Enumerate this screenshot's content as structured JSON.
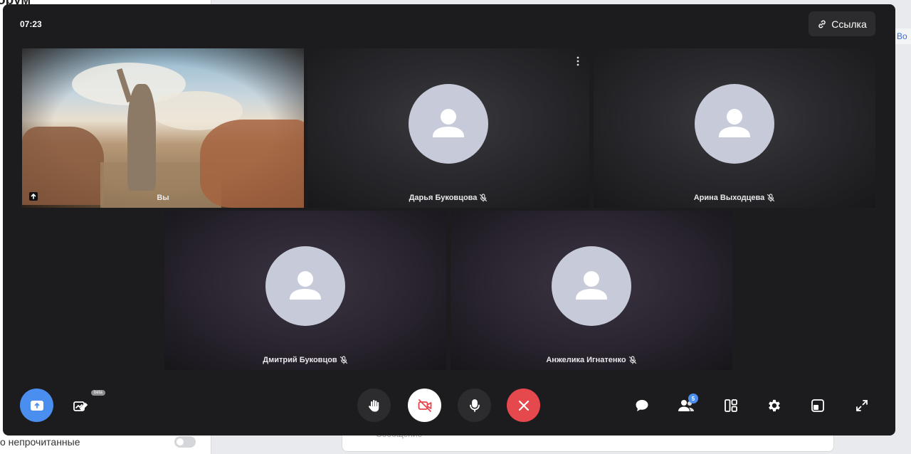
{
  "background": {
    "title_fragment": "орум",
    "unread_filter_label": "о непрочитанные",
    "message_placeholder": "Сообщение",
    "right_fragment": "Во"
  },
  "call": {
    "timer": "07:23",
    "link_button": "Ссылка",
    "participants": [
      {
        "name": "Вы",
        "is_self": true,
        "muted": false
      },
      {
        "name": "Дарья Буковцова",
        "is_self": false,
        "muted": true
      },
      {
        "name": "Арина Выходцева",
        "is_self": false,
        "muted": true
      },
      {
        "name": "Дмитрий Буковцов",
        "is_self": false,
        "muted": true
      },
      {
        "name": "Анжелика Игнатенко",
        "is_self": false,
        "muted": true
      }
    ],
    "controls": {
      "beta_label": "beta",
      "participants_count": "5",
      "accent_color": "#4a8ff0",
      "end_color": "#e5484d"
    }
  }
}
